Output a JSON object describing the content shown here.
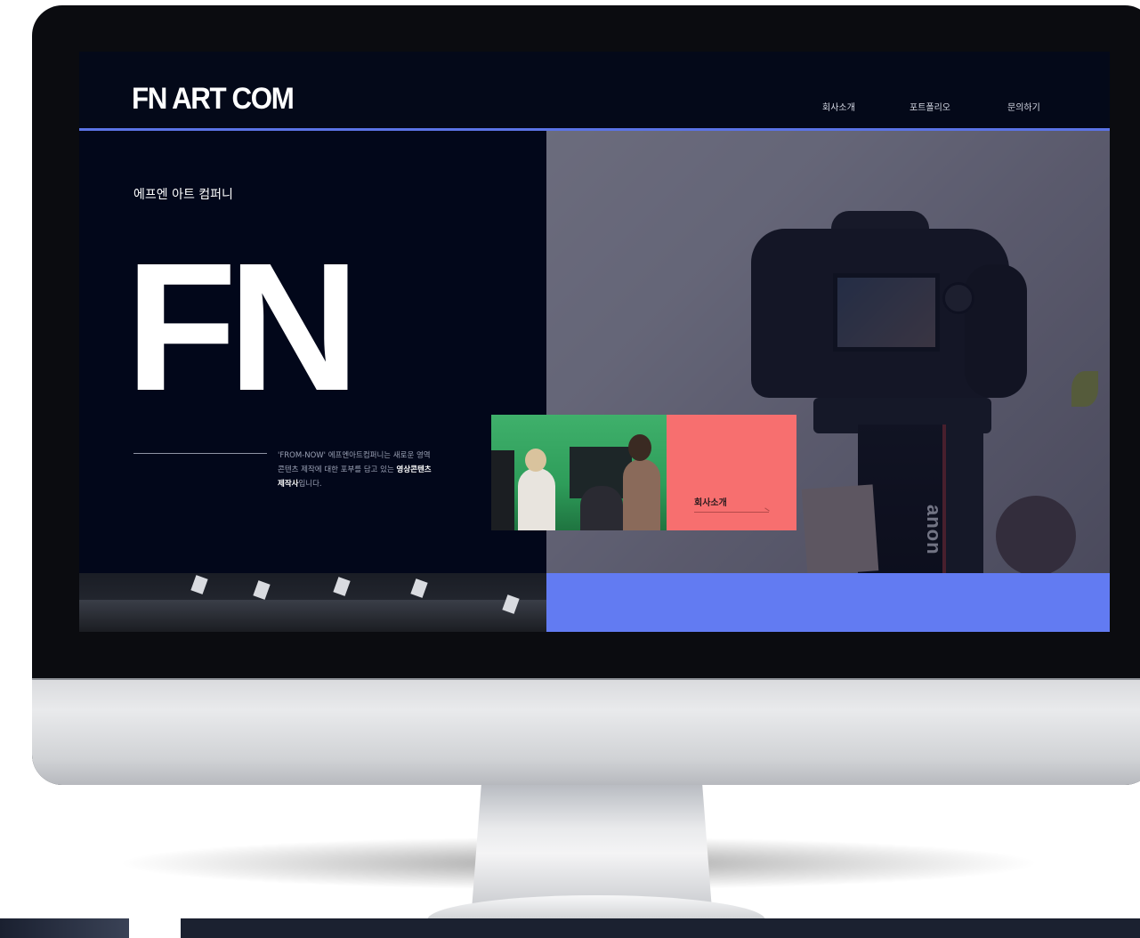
{
  "site": {
    "logo": "FN ART COM",
    "nav": [
      "회사소개",
      "포트폴리오",
      "문의하기"
    ]
  },
  "hero": {
    "subtitle": "에프엔 아트 컴퍼니",
    "big_text": "FN",
    "description_line1": "'FROM-NOW' 에프엔아트컴퍼니는 새로운 영역",
    "description_line2": "콘텐츠 제작에 대한 포부를 담고 있는 ",
    "description_bold": "영상콘텐츠",
    "description_line3_bold": "제작사",
    "description_line3": "입니다."
  },
  "card": {
    "label": "회사소개"
  },
  "photo": {
    "strap_text": "anon"
  },
  "colors": {
    "navy": "#02071a",
    "accent_blue": "#627bf2",
    "nav_line": "#5b73e6",
    "coral": "#f76f6f"
  }
}
